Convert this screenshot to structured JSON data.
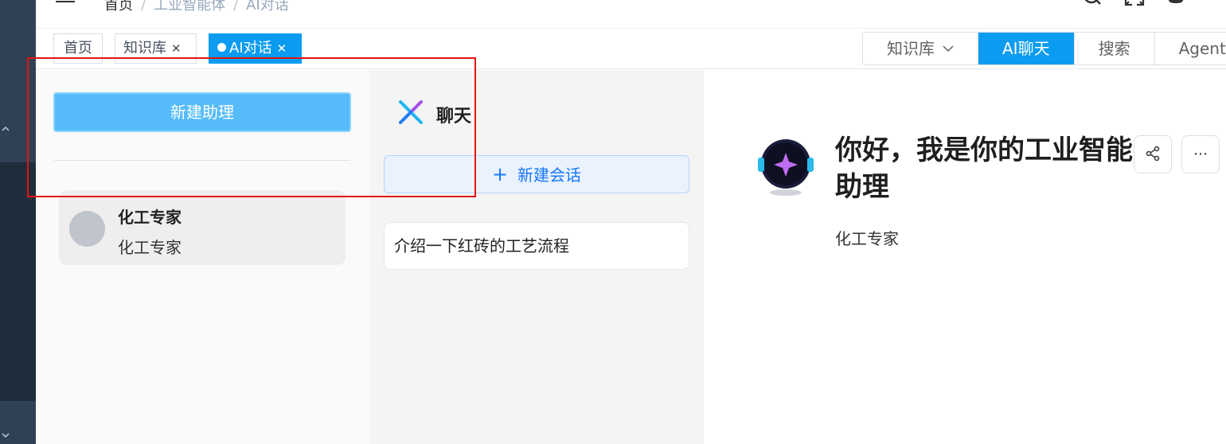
{
  "header": {
    "breadcrumbs": [
      "首页",
      "工业智能体",
      "AI对话"
    ],
    "icons": [
      "search-icon",
      "fullscreen-icon",
      "notification-icon"
    ]
  },
  "tags": [
    {
      "label": "首页",
      "closable": false,
      "active": false
    },
    {
      "label": "知识库",
      "closable": true,
      "active": false
    },
    {
      "label": "AI对话",
      "closable": true,
      "active": true
    }
  ],
  "mode_tabs": [
    {
      "label": "知识库",
      "dropdown": true,
      "active": false
    },
    {
      "label": "AI聊天",
      "dropdown": false,
      "active": true
    },
    {
      "label": "搜索",
      "dropdown": false,
      "active": false
    },
    {
      "label": "Agent",
      "dropdown": false,
      "active": false
    }
  ],
  "assistant_panel": {
    "new_button": "新建助理",
    "assistants": [
      {
        "name": "化工专家",
        "description": "化工专家"
      }
    ]
  },
  "conversation_panel": {
    "title": "聊天",
    "new_button": "新建会话",
    "conversations": [
      "介绍一下红砖的工艺流程"
    ]
  },
  "chat": {
    "greeting": "你好，我是你的工业智能助理",
    "subtitle": "化工专家"
  },
  "colors": {
    "accent": "#0b9cf2",
    "sidebar": "#304156",
    "highlight": "#e3140f"
  }
}
